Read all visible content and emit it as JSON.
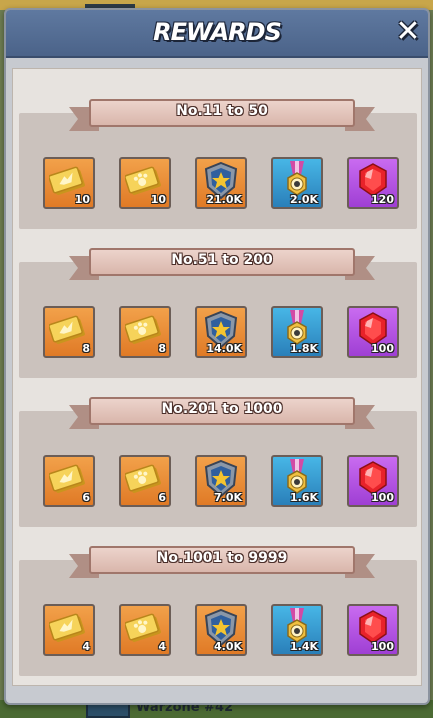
{
  "background": {
    "bottom_label": "Warzone #42"
  },
  "modal": {
    "title": "REWARDS",
    "close_symbol": "✕"
  },
  "tiers": [
    {
      "label": "No.11 to 50",
      "items": [
        {
          "icon": "ticket-bird-icon",
          "count": "10"
        },
        {
          "icon": "ticket-paw-icon",
          "count": "10"
        },
        {
          "icon": "shield-star-icon",
          "count": "21.0K"
        },
        {
          "icon": "medal-icon",
          "count": "2.0K"
        },
        {
          "icon": "ruby-icon",
          "count": "120"
        }
      ]
    },
    {
      "label": "No.51 to 200",
      "items": [
        {
          "icon": "ticket-bird-icon",
          "count": "8"
        },
        {
          "icon": "ticket-paw-icon",
          "count": "8"
        },
        {
          "icon": "shield-star-icon",
          "count": "14.0K"
        },
        {
          "icon": "medal-icon",
          "count": "1.8K"
        },
        {
          "icon": "ruby-icon",
          "count": "100"
        }
      ]
    },
    {
      "label": "No.201 to 1000",
      "items": [
        {
          "icon": "ticket-bird-icon",
          "count": "6"
        },
        {
          "icon": "ticket-paw-icon",
          "count": "6"
        },
        {
          "icon": "shield-star-icon",
          "count": "7.0K"
        },
        {
          "icon": "medal-icon",
          "count": "1.6K"
        },
        {
          "icon": "ruby-icon",
          "count": "100"
        }
      ]
    },
    {
      "label": "No.1001 to 9999",
      "items": [
        {
          "icon": "ticket-bird-icon",
          "count": "4"
        },
        {
          "icon": "ticket-paw-icon",
          "count": "4"
        },
        {
          "icon": "shield-star-icon",
          "count": "4.0K"
        },
        {
          "icon": "medal-icon",
          "count": "1.4K"
        },
        {
          "icon": "ruby-icon",
          "count": "100"
        }
      ]
    }
  ],
  "colors": {
    "orange_tile": "#e88a33",
    "blue_tile": "#3a9ed6",
    "purple_tile": "#b556e2",
    "header": "#556e96"
  }
}
